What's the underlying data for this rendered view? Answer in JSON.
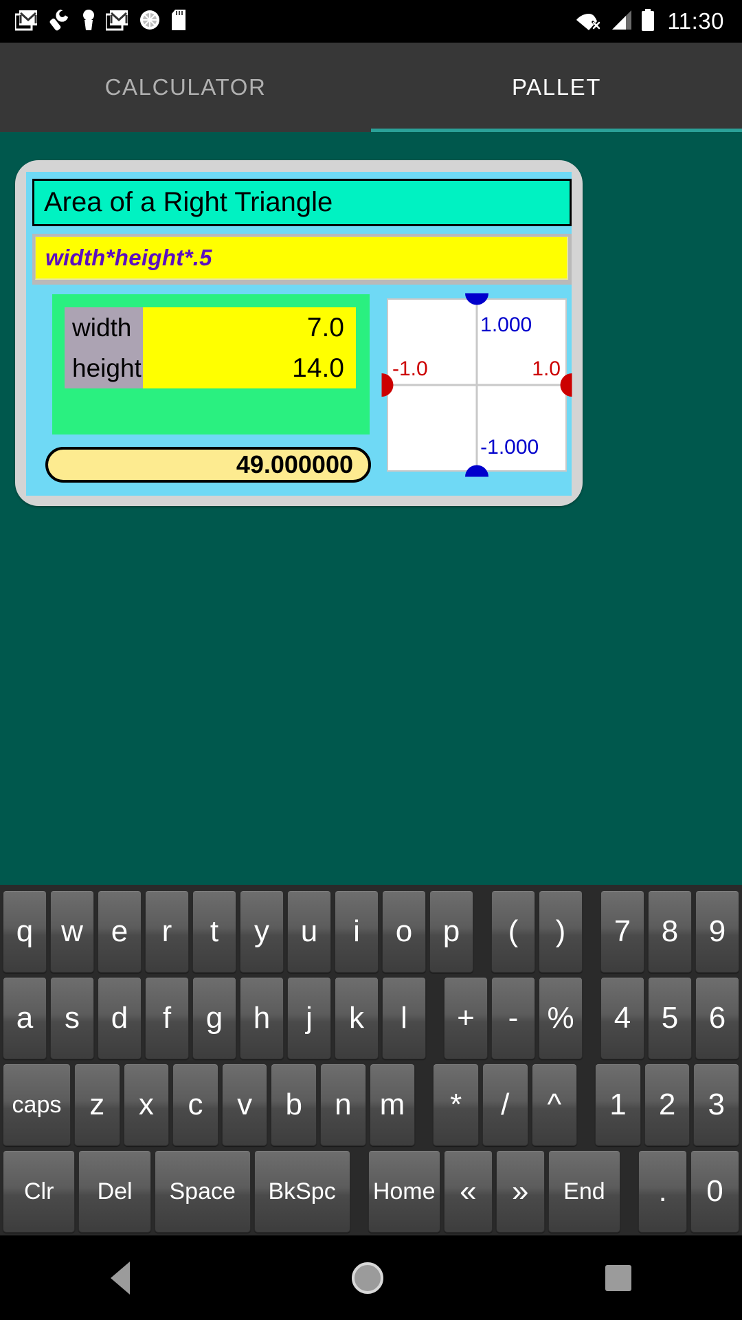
{
  "status_bar": {
    "time": "11:30",
    "left_icons": [
      "gmail-icon",
      "wrench-icon",
      "keyhole-icon",
      "gmail-icon",
      "clock-dial-icon",
      "sd-card-icon"
    ],
    "right_icons": [
      "wifi-off-icon",
      "cell-signal-icon",
      "battery-full-icon"
    ]
  },
  "tabs": [
    {
      "label": "CALCULATOR",
      "active": false
    },
    {
      "label": "PALLET",
      "active": true
    }
  ],
  "colors": {
    "background_teal": "#00584d",
    "tab_bar": "#373737",
    "tab_accent": "#2aa198",
    "card_frame": "#d4d4d4",
    "card_inner": "#6fd9f5",
    "title_bg": "#00f2c2",
    "formula_bg": "#ffff00",
    "formula_text": "#5c0fc0",
    "vars_panel": "#2af080",
    "var_name_bg": "#aca3b3",
    "var_value_bg": "#ffff00",
    "result_bg": "#fdeb90",
    "graph_marker_blue": "#0000cc",
    "graph_marker_red": "#cc0000",
    "graph_grid": "#c9c9c9"
  },
  "card": {
    "title": "Area of a Right Triangle",
    "formula": "width*height*.5",
    "variables": [
      {
        "name": "width",
        "value": "7.0"
      },
      {
        "name": "height",
        "value": "14.0"
      }
    ],
    "result": "49.000000",
    "graph": {
      "top_label": "1.000",
      "bottom_label": "-1.000",
      "left_label": "-1.0",
      "right_label": "1.0"
    }
  },
  "keyboard": {
    "rows": [
      {
        "groups": [
          [
            "q",
            "w",
            "e",
            "r",
            "t",
            "y",
            "u",
            "i",
            "o",
            "p"
          ],
          [
            "(",
            ")"
          ],
          [
            "7",
            "8",
            "9"
          ]
        ]
      },
      {
        "groups": [
          [
            "a",
            "s",
            "d",
            "f",
            "g",
            "h",
            "j",
            "k",
            "l"
          ],
          [
            "+",
            "-",
            "%"
          ],
          [
            "4",
            "5",
            "6"
          ]
        ]
      },
      {
        "groups": [
          [
            "caps",
            "z",
            "x",
            "c",
            "v",
            "b",
            "n",
            "m"
          ],
          [
            "*",
            "/",
            "^"
          ],
          [
            "1",
            "2",
            "3"
          ]
        ]
      },
      {
        "groups": [
          [
            "Clr",
            "Del",
            "Space",
            "BkSpc"
          ],
          [
            "Home",
            "«",
            "»",
            "End"
          ],
          [
            ".",
            "0"
          ]
        ]
      }
    ]
  },
  "nav_bar": {
    "items": [
      "back-icon",
      "home-icon",
      "recents-icon"
    ]
  }
}
